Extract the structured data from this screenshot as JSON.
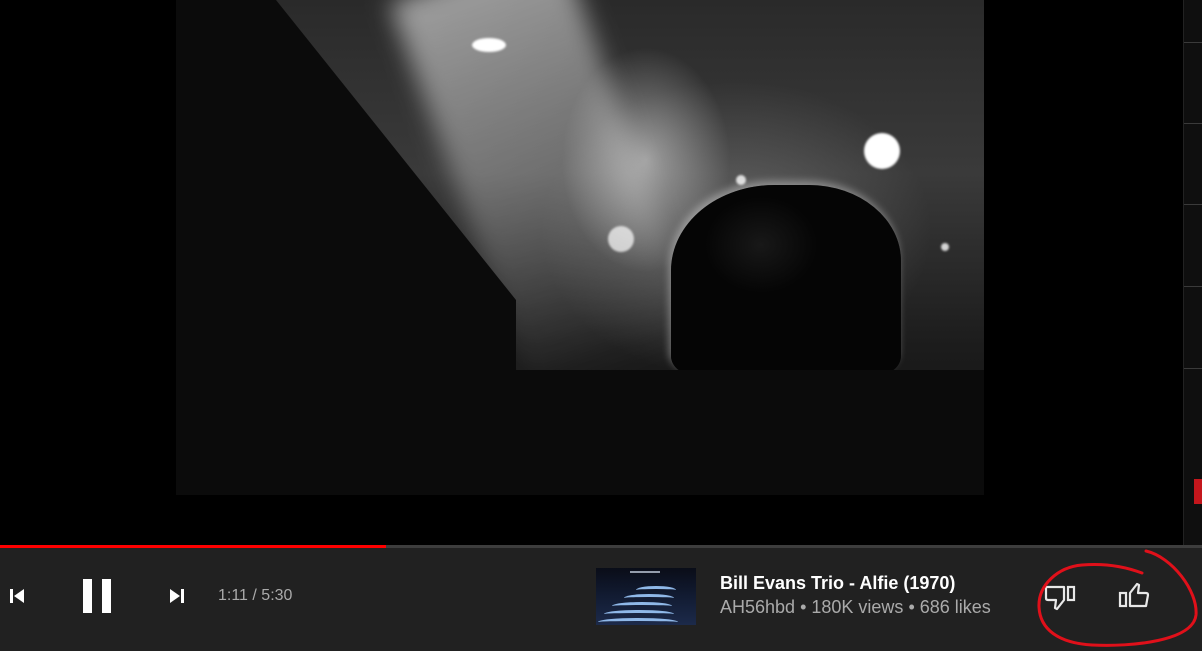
{
  "player": {
    "progress": 0.321,
    "time_current": "1:11",
    "time_separator": " / ",
    "time_total": "5:30",
    "icons": {
      "previous": "skip-previous-icon",
      "pause": "pause-icon",
      "next": "skip-next-icon",
      "dislike": "thumbs-down-icon",
      "like": "thumbs-up-icon"
    }
  },
  "track": {
    "title": "Bill Evans Trio - Alfie (1970)",
    "channel": "AH56hbd",
    "views": "180K views",
    "likes": "686 likes",
    "separator": "•"
  },
  "colors": {
    "accent": "#ff0000",
    "bar_background": "#212121",
    "secondary_text": "#aaaaaa",
    "annotation": "#e0101a"
  }
}
